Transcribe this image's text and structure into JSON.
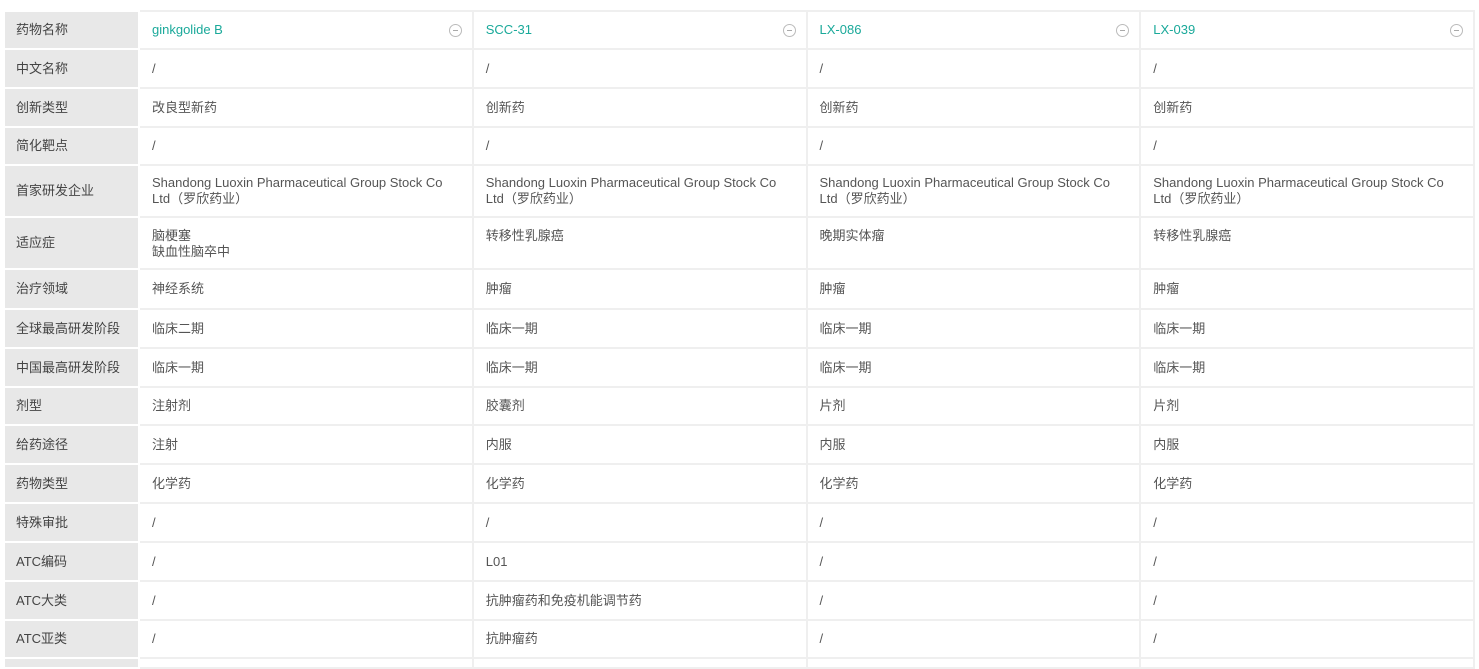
{
  "drugs": [
    {
      "name": "ginkgolide B",
      "cn_name": "/",
      "innovation": "改良型新药",
      "target": "/",
      "company": "Shandong Luoxin Pharmaceutical Group Stock Co Ltd（罗欣药业）",
      "indication": [
        "脑梗塞",
        "缺血性脑卒中"
      ],
      "area": "神经系统",
      "global_stage": "临床二期",
      "china_stage": "临床一期",
      "form": "注射剂",
      "route": "注射",
      "type": "化学药",
      "special": "/",
      "atc_code": "/",
      "atc_class": "/",
      "atc_sub": "/"
    },
    {
      "name": "SCC-31",
      "cn_name": "/",
      "innovation": "创新药",
      "target": "/",
      "company": "Shandong Luoxin Pharmaceutical Group Stock Co Ltd（罗欣药业）",
      "indication": [
        "转移性乳腺癌"
      ],
      "area": "肿瘤",
      "global_stage": "临床一期",
      "china_stage": "临床一期",
      "form": "胶囊剂",
      "route": "内服",
      "type": "化学药",
      "special": "/",
      "atc_code": "L01",
      "atc_class": "抗肿瘤药和免疫机能调节药",
      "atc_sub": "抗肿瘤药"
    },
    {
      "name": "LX-086",
      "cn_name": "/",
      "innovation": "创新药",
      "target": "/",
      "company": "Shandong Luoxin Pharmaceutical Group Stock Co Ltd（罗欣药业）",
      "indication": [
        "晚期实体瘤"
      ],
      "area": "肿瘤",
      "global_stage": "临床一期",
      "china_stage": "临床一期",
      "form": "片剂",
      "route": "内服",
      "type": "化学药",
      "special": "/",
      "atc_code": "/",
      "atc_class": "/",
      "atc_sub": "/"
    },
    {
      "name": "LX-039",
      "cn_name": "/",
      "innovation": "创新药",
      "target": "/",
      "company": "Shandong Luoxin Pharmaceutical Group Stock Co Ltd（罗欣药业）",
      "indication": [
        "转移性乳腺癌"
      ],
      "area": "肿瘤",
      "global_stage": "临床一期",
      "china_stage": "临床一期",
      "form": "片剂",
      "route": "内服",
      "type": "化学药",
      "special": "/",
      "atc_code": "/",
      "atc_class": "/",
      "atc_sub": "/"
    }
  ],
  "rows": [
    {
      "key": "name",
      "label": "药物名称"
    },
    {
      "key": "cn_name",
      "label": "中文名称"
    },
    {
      "key": "innovation",
      "label": "创新类型"
    },
    {
      "key": "target",
      "label": "简化靶点"
    },
    {
      "key": "company",
      "label": "首家研发企业"
    },
    {
      "key": "indication",
      "label": "适应症"
    },
    {
      "key": "area",
      "label": "治疗领域"
    },
    {
      "key": "global_stage",
      "label": "全球最高研发阶段"
    },
    {
      "key": "china_stage",
      "label": "中国最高研发阶段"
    },
    {
      "key": "form",
      "label": "剂型"
    },
    {
      "key": "route",
      "label": "给药途径"
    },
    {
      "key": "type",
      "label": "药物类型"
    },
    {
      "key": "special",
      "label": "特殊审批"
    },
    {
      "key": "atc_code",
      "label": "ATC编码"
    },
    {
      "key": "atc_class",
      "label": "ATC大类"
    },
    {
      "key": "atc_sub",
      "label": "ATC亚类"
    }
  ]
}
